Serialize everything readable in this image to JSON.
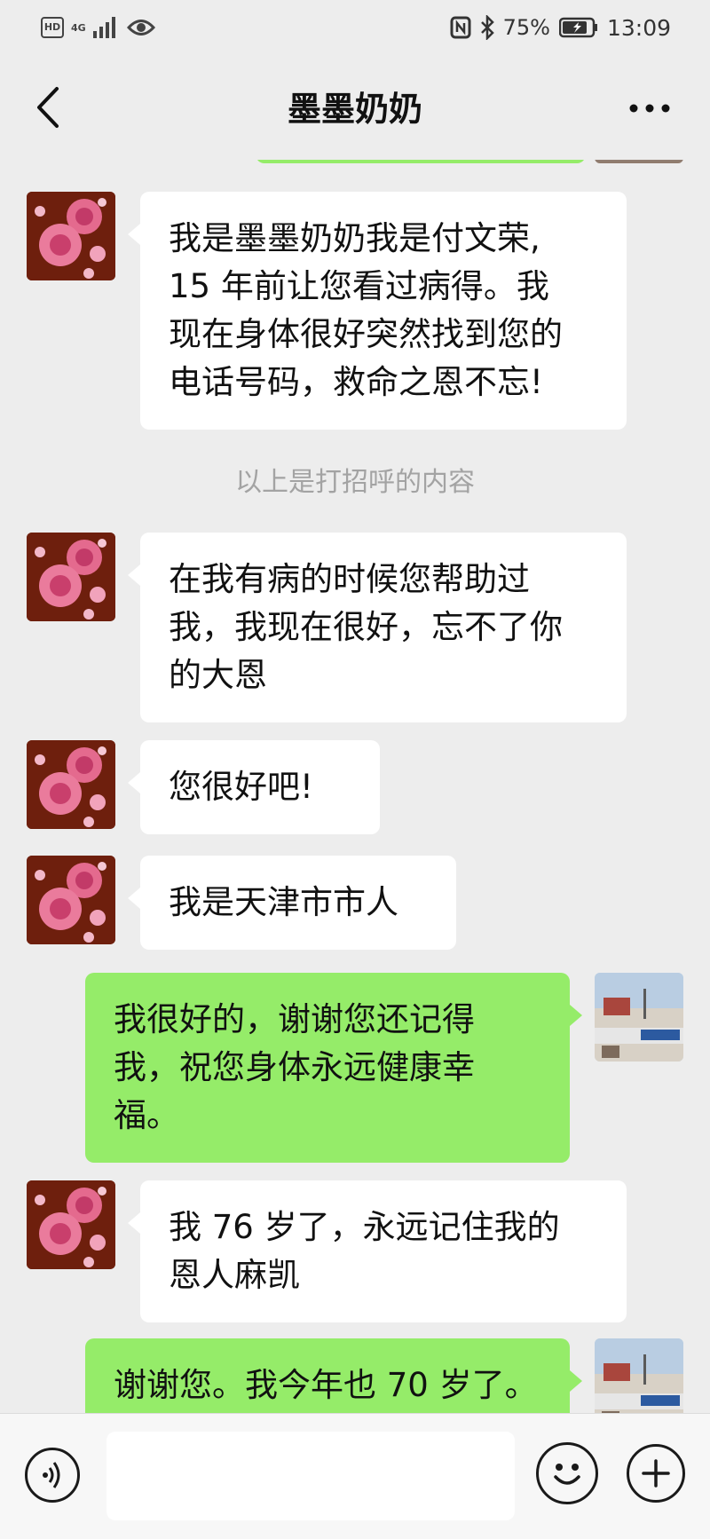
{
  "status_bar": {
    "hd": "HD",
    "network": "4G",
    "battery": "75%",
    "time": "13:09"
  },
  "header": {
    "title": "墨墨奶奶"
  },
  "messages": [
    {
      "side": "in",
      "lines": [
        "我是墨墨奶奶我是付文荣,",
        "15 年前让您看过病得。我",
        "现在身体很好突然找到您的",
        "电话号码，救命之恩不忘!"
      ]
    },
    {
      "type": "system",
      "text": "以上是打招呼的内容"
    },
    {
      "side": "in",
      "lines": [
        "在我有病的时候您帮助过",
        "我，我现在很好，忘不了你",
        "的大恩"
      ]
    },
    {
      "side": "in",
      "lines": [
        "您很好吧!"
      ]
    },
    {
      "side": "in",
      "lines": [
        "我是天津市市人"
      ]
    },
    {
      "side": "out",
      "lines": [
        "我很好的，谢谢您还记得",
        "我，祝您身体永远健康幸",
        "福。"
      ]
    },
    {
      "side": "in",
      "lines": [
        "我 76 岁了，永远记住我的",
        "恩人麻凯"
      ]
    },
    {
      "side": "out",
      "lines": [
        "谢谢您。我今年也 70 岁了。"
      ]
    }
  ],
  "input_bar": {
    "placeholder": ""
  },
  "colors": {
    "background": "#ededed",
    "bubble_in": "#ffffff",
    "bubble_out": "#95ec69",
    "system_text": "#a3a3a3"
  },
  "icons": [
    "back-icon",
    "more-icon",
    "voice-icon",
    "emoji-icon",
    "plus-icon",
    "signal-icon",
    "eye-icon",
    "nfc-icon",
    "bluetooth-icon",
    "battery-icon"
  ]
}
